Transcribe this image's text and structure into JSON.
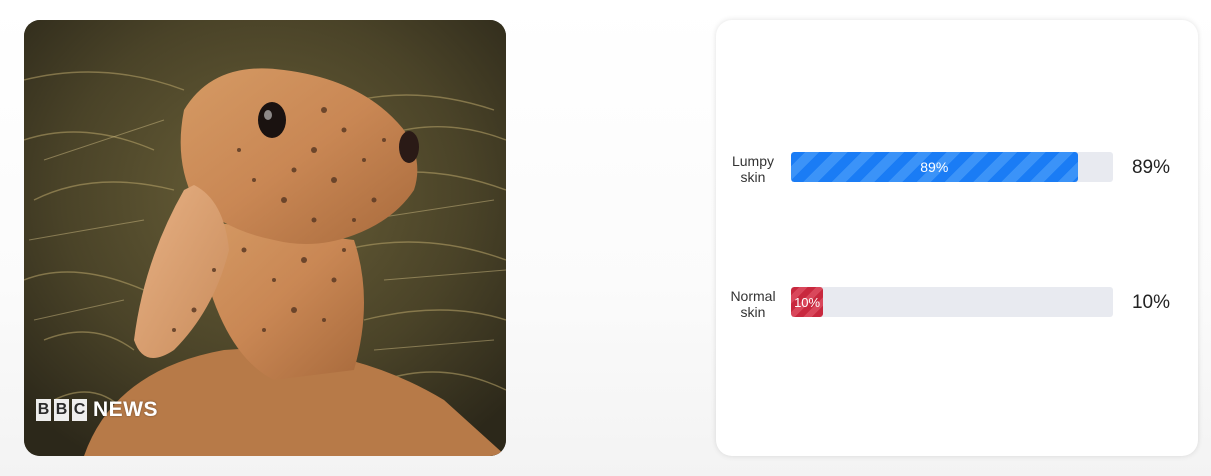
{
  "photo": {
    "watermark": {
      "letters": [
        "B",
        "B",
        "C"
      ],
      "news": "NEWS"
    }
  },
  "poll": {
    "options": [
      {
        "label_line1": "Lumpy",
        "label_line2": "skin",
        "bar_text": "89%",
        "percent_text": "89%",
        "fraction": 0.89,
        "color": "#1a7cf5"
      },
      {
        "label_line1": "Normal",
        "label_line2": "skin",
        "bar_text": "10%",
        "percent_text": "10%",
        "fraction": 0.1,
        "color": "#c8283e"
      }
    ]
  }
}
